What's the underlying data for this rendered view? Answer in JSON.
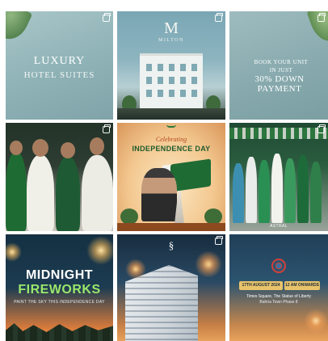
{
  "grid": {
    "posts": [
      {
        "id": "luxury-hotel-suites",
        "line1": "LUXURY",
        "line2": "HOTEL SUITES",
        "multi": true,
        "bg": "#8eb2b6"
      },
      {
        "id": "milton-hotel",
        "logo_mark": "M",
        "logo_text": "MILTON",
        "multi": true,
        "bg": "#7aa6b4"
      },
      {
        "id": "down-payment",
        "line1": "BOOK YOUR UNIT",
        "line1b": "IN JUST",
        "line2": "30% DOWN PAYMENT",
        "multi": true,
        "bg": "#87a9ad"
      },
      {
        "id": "independence-celebration-group",
        "multi": true,
        "bg": "#2f3d33"
      },
      {
        "id": "celebrating-independence-day",
        "celebrating": "Celebrating",
        "independence": "INDEPENDENCE DAY",
        "multi": false,
        "bg": "#f3c890"
      },
      {
        "id": "group-with-flags",
        "badge": "ASTRAL",
        "multi": true,
        "bg": "#2c5d40"
      },
      {
        "id": "midnight-fireworks",
        "line1": "MIDNIGHT",
        "line2": "FIREWORKS",
        "sub": "PAINT THE SKY THIS INDEPENDENCE DAY",
        "multi": false,
        "bg": "#1d3c52"
      },
      {
        "id": "tower-fireworks",
        "multi": true,
        "bg": "#2a4a64"
      },
      {
        "id": "event-details",
        "date": "17TH AUGUST 2024",
        "time": "12 AM ONWARDS",
        "venue1": "Times Square, The Statue of Liberty",
        "venue2": "Bahria Town Phase 8",
        "multi": false,
        "bg": "#2c5470"
      }
    ]
  },
  "colors": {
    "accent_green": "#9be86b",
    "flag_green": "#1f6b34",
    "pill_gold": "#e8c36b"
  }
}
